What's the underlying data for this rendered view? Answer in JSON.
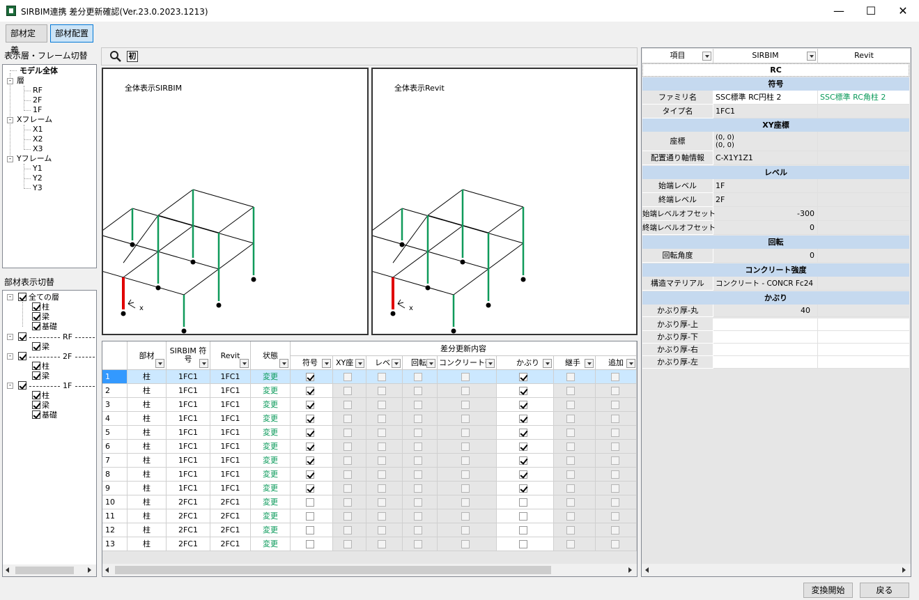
{
  "window": {
    "title": "SIRBIM連携 差分更新確認(Ver.23.0.2023.1213)",
    "minimize": "—",
    "maximize": "☐",
    "close": "✕"
  },
  "toolbar": {
    "tab_definition": "部材定義",
    "tab_placement": "部材配置"
  },
  "floor_frame_panel": {
    "title": "表示層・フレーム切替",
    "root": "モデル全体",
    "groups": [
      {
        "label": "層",
        "items": [
          "RF",
          "2F",
          "1F"
        ]
      },
      {
        "label": "Xフレーム",
        "items": [
          "X1",
          "X2",
          "X3"
        ]
      },
      {
        "label": "Yフレーム",
        "items": [
          "Y1",
          "Y2",
          "Y3"
        ]
      }
    ]
  },
  "member_panel": {
    "title": "部材表示切替",
    "all_floors": "全ての層",
    "all_items": [
      "柱",
      "梁",
      "基礎"
    ],
    "rf": "RF",
    "rf_items": [
      "梁"
    ],
    "f2": "2F",
    "f2_items": [
      "柱",
      "梁"
    ],
    "f1": "1F",
    "f1_items": [
      "柱",
      "梁",
      "基礎"
    ]
  },
  "view_toolbar": {
    "fit_glyph": "初"
  },
  "view_sirbim": {
    "label": "全体表示SIRBIM",
    "axis": "x"
  },
  "view_revit": {
    "label": "全体表示Revit",
    "axis": "x"
  },
  "grid": {
    "group_header": "差分更新内容",
    "headers": {
      "member": "部材",
      "sirbim": "SIRBIM 符号",
      "revit": "Revit",
      "state": "状態",
      "sign": "符号",
      "xy": "XY座",
      "level": "レベ",
      "rotation": "回転",
      "concrete": "コンクリート強",
      "cover": "かぶり",
      "joint": "継手",
      "add": "追加"
    },
    "rows": [
      {
        "no": "1",
        "member": "柱",
        "sirbim": "1FC1",
        "revit": "1FC1",
        "state": "変更",
        "sign": true,
        "cover": true
      },
      {
        "no": "2",
        "member": "柱",
        "sirbim": "1FC1",
        "revit": "1FC1",
        "state": "変更",
        "sign": true,
        "cover": true
      },
      {
        "no": "3",
        "member": "柱",
        "sirbim": "1FC1",
        "revit": "1FC1",
        "state": "変更",
        "sign": true,
        "cover": true
      },
      {
        "no": "4",
        "member": "柱",
        "sirbim": "1FC1",
        "revit": "1FC1",
        "state": "変更",
        "sign": true,
        "cover": true
      },
      {
        "no": "5",
        "member": "柱",
        "sirbim": "1FC1",
        "revit": "1FC1",
        "state": "変更",
        "sign": true,
        "cover": true
      },
      {
        "no": "6",
        "member": "柱",
        "sirbim": "1FC1",
        "revit": "1FC1",
        "state": "変更",
        "sign": true,
        "cover": true
      },
      {
        "no": "7",
        "member": "柱",
        "sirbim": "1FC1",
        "revit": "1FC1",
        "state": "変更",
        "sign": true,
        "cover": true
      },
      {
        "no": "8",
        "member": "柱",
        "sirbim": "1FC1",
        "revit": "1FC1",
        "state": "変更",
        "sign": true,
        "cover": true
      },
      {
        "no": "9",
        "member": "柱",
        "sirbim": "1FC1",
        "revit": "1FC1",
        "state": "変更",
        "sign": true,
        "cover": true
      },
      {
        "no": "10",
        "member": "柱",
        "sirbim": "2FC1",
        "revit": "2FC1",
        "state": "変更",
        "sign": false,
        "cover": false
      },
      {
        "no": "11",
        "member": "柱",
        "sirbim": "2FC1",
        "revit": "2FC1",
        "state": "変更",
        "sign": false,
        "cover": false
      },
      {
        "no": "12",
        "member": "柱",
        "sirbim": "2FC1",
        "revit": "2FC1",
        "state": "変更",
        "sign": false,
        "cover": false
      },
      {
        "no": "13",
        "member": "柱",
        "sirbim": "2FC1",
        "revit": "2FC1",
        "state": "変更",
        "sign": false,
        "cover": false
      }
    ]
  },
  "props": {
    "headers": {
      "item": "項目",
      "sirbim": "SIRBIM",
      "revit": "Revit"
    },
    "rc": "RC",
    "sec_sign": "符号",
    "family_label": "ファミリ名",
    "family_sirbim": "SSC標準 RC円柱 2",
    "family_revit": "SSC標準 RC角柱 2",
    "type_label": "タイプ名",
    "type_sirbim": "1FC1",
    "sec_xy": "XY座標",
    "coord_label": "座標",
    "coord_l1": "(0, 0)",
    "coord_l2": "(0, 0)",
    "axis_label": "配置通り軸情報",
    "axis_value": "C-X1Y1Z1",
    "sec_level": "レベル",
    "start_level_label": "始端レベル",
    "start_level": "1F",
    "end_level_label": "終端レベル",
    "end_level": "2F",
    "start_offset_label": "始端レベルオフセット",
    "start_offset": "-300",
    "end_offset_label": "終端レベルオフセット",
    "end_offset": "0",
    "sec_rotation": "回転",
    "rotation_label": "回転角度",
    "rotation": "0",
    "sec_concrete": "コンクリート強度",
    "material_label": "構造マテリアル",
    "material": "コンクリート - CONCR Fc24",
    "sec_cover": "かぶり",
    "cover_round_label": "かぶり厚-丸",
    "cover_round": "40",
    "cover_top_label": "かぶり厚-上",
    "cover_bottom_label": "かぶり厚-下",
    "cover_right_label": "かぶり厚-右",
    "cover_left_label": "かぶり厚-左"
  },
  "footer": {
    "convert": "変換開始",
    "back": "戻る"
  },
  "colors": {
    "selected_row": "#cce8ff",
    "state_text": "#0a9a5a",
    "section": "#c5d9ef",
    "column_green": "#0f9a5a",
    "column_red": "#e00000"
  }
}
